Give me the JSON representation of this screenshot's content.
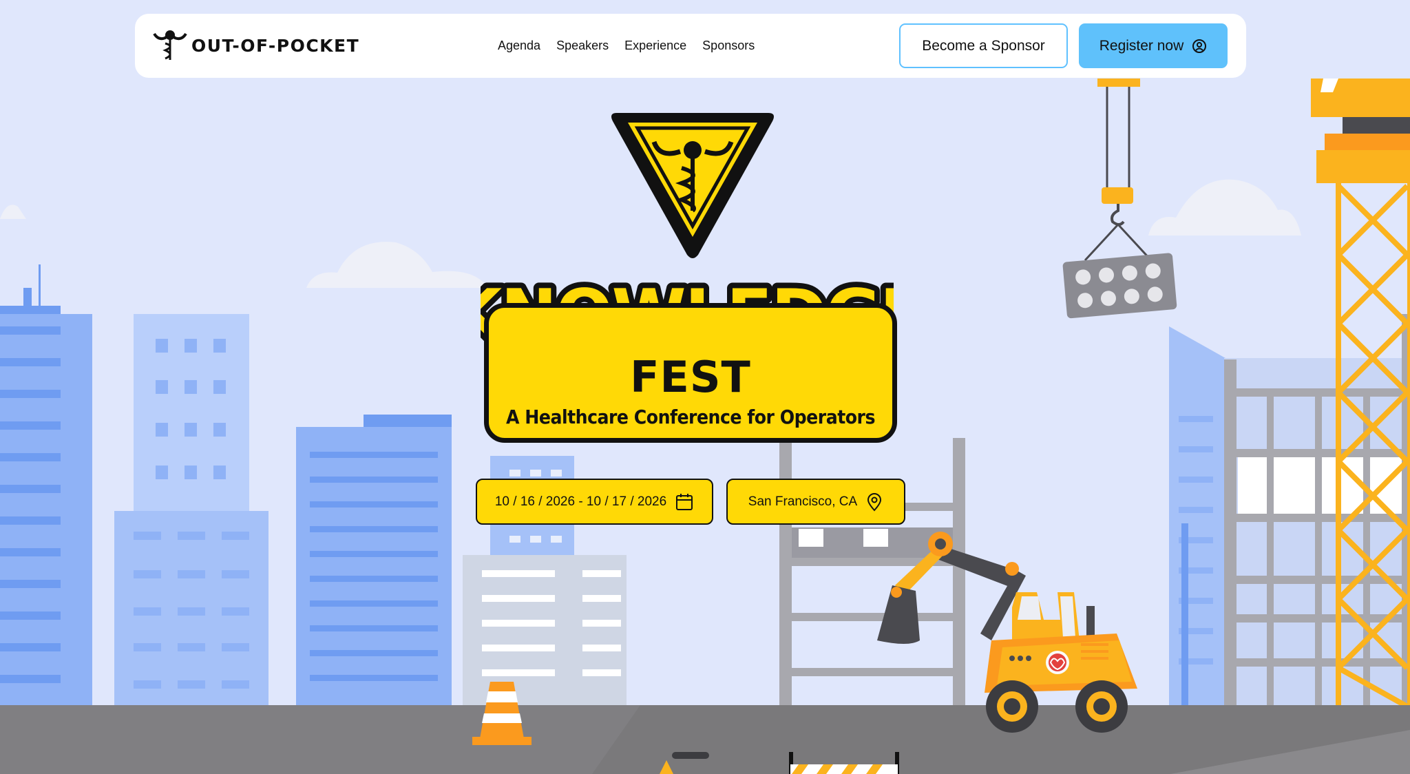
{
  "nav": {
    "logo_text": "OUT-OF-POCKET",
    "links": [
      {
        "label": "Agenda"
      },
      {
        "label": "Speakers"
      },
      {
        "label": "Experience"
      },
      {
        "label": "Sponsors"
      }
    ],
    "sponsor_button": "Become a Sponsor",
    "register_button": "Register now",
    "register_icon": "user-circle-icon"
  },
  "hero": {
    "title_word": "KNOWLEDGE",
    "title_fest": "FEST",
    "subtitle": "A Healthcare Conference for Operators",
    "date_range": "10 / 16 / 2026 - 10 / 17 / 2026",
    "date_icon": "calendar-icon",
    "location": "San Francisco, CA",
    "location_icon": "map-pin-icon",
    "badge_icon": "caduceus-warning-sign-icon"
  },
  "colors": {
    "sky": "#e0e7fc",
    "accent_yellow": "#ffd906",
    "register_blue": "#5fc1fb",
    "ground": "#7a797b"
  }
}
